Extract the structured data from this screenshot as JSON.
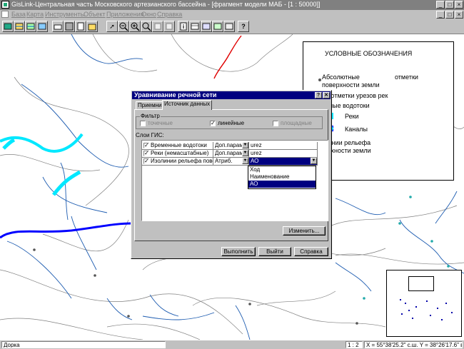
{
  "window": {
    "title": "GisLink-Центральная часть Московского артезианского бассейна - [фрагмент модели МАБ - [1 : 50000]]"
  },
  "menu": [
    "База",
    "Карта",
    "Инструменты",
    "Объект",
    "Приложения",
    "Окно",
    "Справка"
  ],
  "toolbar_icons": [
    "db-icon",
    "layers-icon",
    "layers2-icon",
    "fill-icon",
    "print-icon",
    "pointer-icon",
    "zoom-out-icon",
    "zoom-in-icon",
    "zoom-window-icon",
    "copy-icon",
    "grid-icon",
    "info-icon",
    "table-icon",
    "table2-icon",
    "save-icon",
    "doc-icon",
    "help-icon"
  ],
  "legend": {
    "title": "УСЛОВНЫЕ ОБОЗНАЧЕНИЯ",
    "abs_marks_line1": "Абсолютные",
    "abs_marks_word2": "отметки",
    "abs_marks_line2": "поверхности земли",
    "urez": "Абс. отметки урезов рек",
    "temp_streams": "Временные водотоки",
    "rivers": "Реки",
    "canals": "Каналы",
    "isolines_line1": "Изолинии рельефа",
    "isolines_line2": "поверхности земли",
    "colors": {
      "rivers": "#00e8ff",
      "canals": "#0000ff"
    }
  },
  "dialog": {
    "title": "Уравнивание речной сети",
    "help_btn": "?",
    "close_btn": "✕",
    "tabs": {
      "receiver": "Приемник",
      "source": "Источник данных"
    },
    "filter": {
      "label": "Фильтр",
      "point": "точечные",
      "line": "линейные",
      "area": "площадные"
    },
    "gis_layers_label": "Слои ГИС:",
    "rows": [
      {
        "name": "Временные водотоки",
        "param": "Доп.парам.",
        "value": "urez"
      },
      {
        "name": "Реки (немасштабные)",
        "param": "Доп.парам.",
        "value": "urez"
      },
      {
        "name": "Изолинии рельефа поверх",
        "param": "Атриб.",
        "value": "АО"
      }
    ],
    "dropdown_options": [
      "Ход",
      "Наименование",
      "АО"
    ],
    "change_btn": "Изменить...",
    "run_btn": "Выполнить",
    "exit_btn": "Выйти",
    "help_button": "Справка"
  },
  "status": {
    "layer": "Дорка",
    "scale": "1 : 2",
    "coords": "X = 55°38'25.2\" с.ш.  Y = 38°26'17.6\" в.д"
  }
}
